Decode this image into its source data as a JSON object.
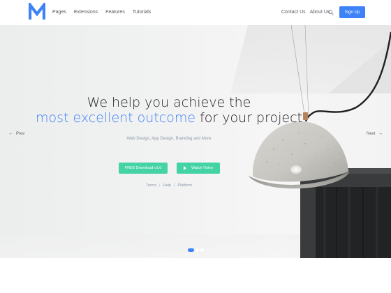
{
  "nav": {
    "brand_letter": "M",
    "links": [
      "Pages",
      "Extensions",
      "Features",
      "Tutorials"
    ],
    "right_links": [
      "Contact Us",
      "About Us"
    ],
    "signup_label": "Sign Up",
    "search_icon": "search-icon"
  },
  "hero": {
    "headline_line1": "We help you achieve the",
    "headline_accent": "most excellent outcome",
    "headline_rest": " for your project",
    "subtitle": "Web Design, App Design, Branding and More",
    "prev_label": "Prev",
    "next_label": "Next",
    "download_label": "FREE Download v1.0",
    "video_label": "Watch Video",
    "links": [
      "Terms",
      "Help",
      "Platform"
    ],
    "slide_count": 3,
    "active_slide": 1
  },
  "colors": {
    "accent": "#3e82f7",
    "button_green": "#43d3a4",
    "text_dark": "#1e1f22",
    "text_muted": "#8b9aaa"
  }
}
